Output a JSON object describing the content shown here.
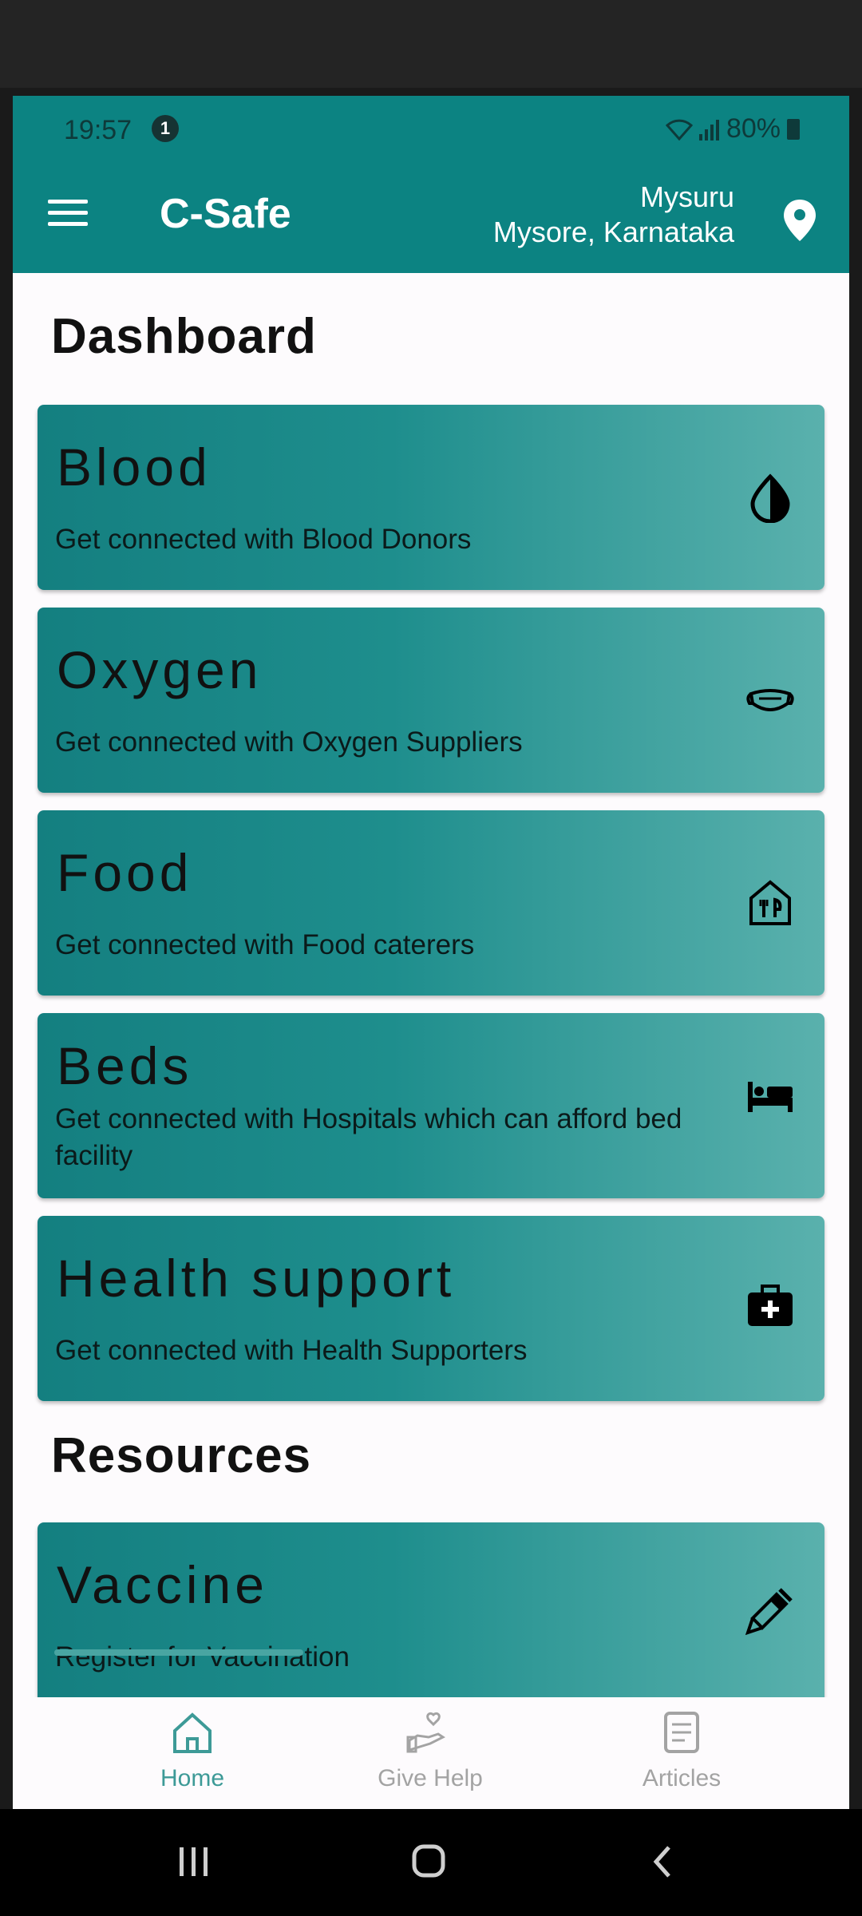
{
  "status_bar": {
    "time": "19:57",
    "notification_count": "1",
    "battery": "80%"
  },
  "appbar": {
    "title": "C-Safe",
    "location_city": "Mysuru",
    "location_state": "Mysore, Karnataka"
  },
  "sections": {
    "dashboard_title": "Dashboard",
    "resources_title": "Resources"
  },
  "cards": [
    {
      "title": "Blood",
      "subtitle": "Get connected with Blood Donors",
      "icon": "blood-drop-icon"
    },
    {
      "title": "Oxygen",
      "subtitle": "Get connected with Oxygen Suppliers",
      "icon": "mask-icon"
    },
    {
      "title": "Food",
      "subtitle": "Get connected with Food caterers",
      "icon": "food-house-icon"
    },
    {
      "title": "Beds",
      "subtitle": "Get connected with Hospitals which can afford bed facility",
      "icon": "bed-icon"
    },
    {
      "title": "Health support",
      "subtitle": "Get connected with Health Supporters",
      "icon": "medical-kit-icon"
    }
  ],
  "resources": [
    {
      "title": "Vaccine",
      "subtitle": "Register for Vaccination",
      "icon": "syringe-icon"
    }
  ],
  "bottom_nav": [
    {
      "label": "Home",
      "icon": "home-icon",
      "active": true
    },
    {
      "label": "Give Help",
      "icon": "give-help-icon",
      "active": false
    },
    {
      "label": "Articles",
      "icon": "articles-icon",
      "active": false
    }
  ],
  "colors": {
    "primary": "#0c8382",
    "nav_active": "#3d9a97",
    "nav_inactive": "#a3a3a3"
  }
}
